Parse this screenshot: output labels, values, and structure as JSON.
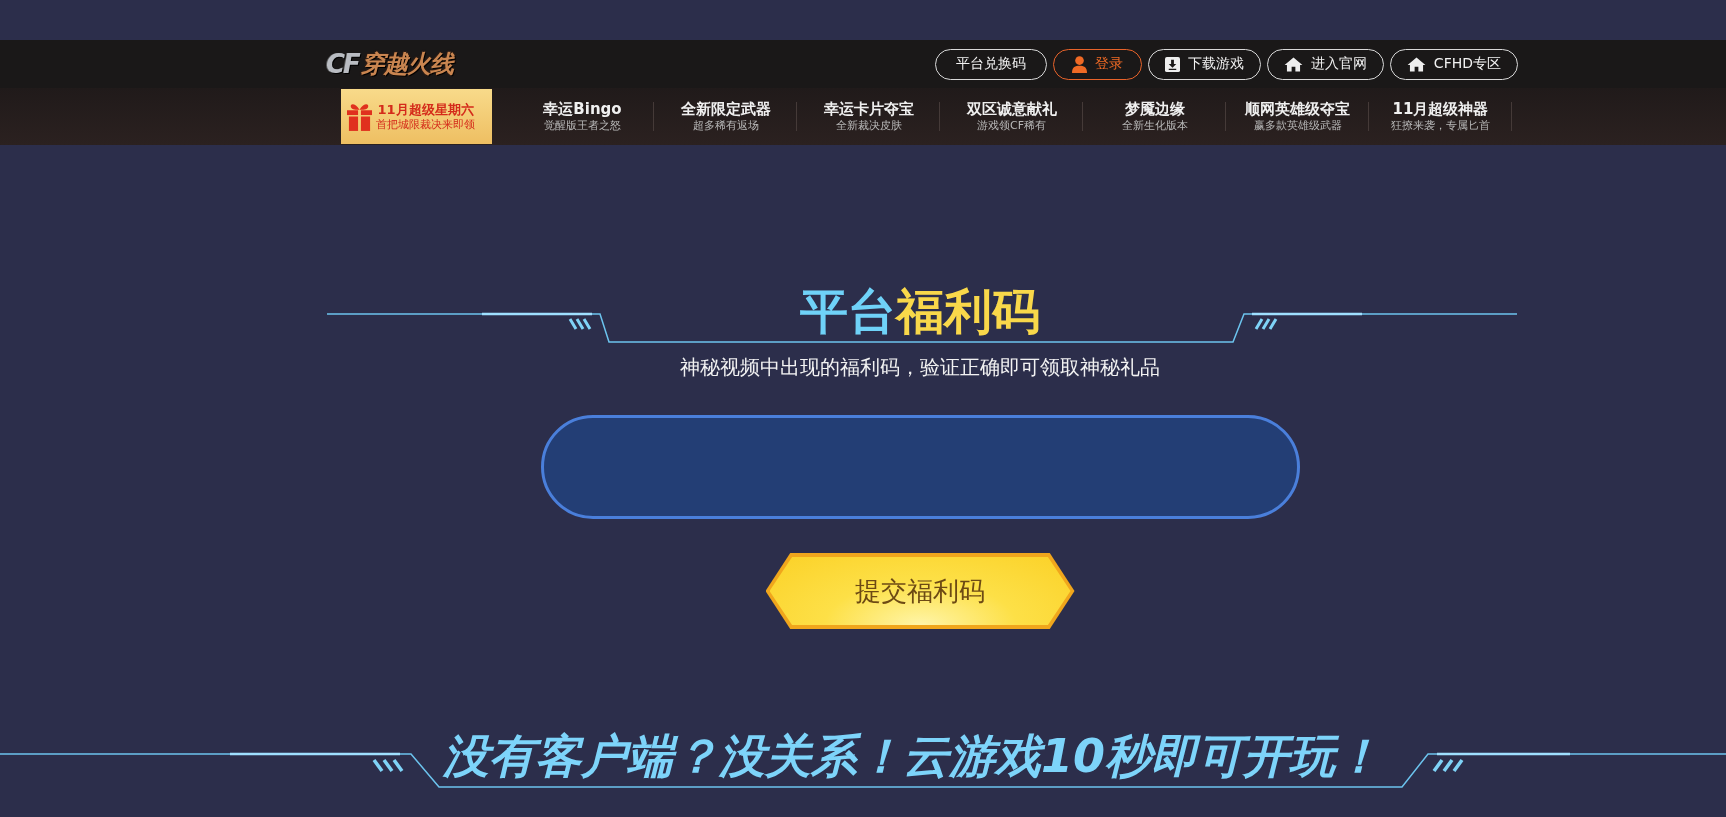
{
  "logo": {
    "mark": "CF",
    "name": "穿越火线"
  },
  "header_buttons": [
    {
      "label": "平台兑换码",
      "kind": "plain"
    },
    {
      "label": "登录",
      "kind": "login"
    },
    {
      "label": "下载游戏",
      "kind": "download"
    },
    {
      "label": "进入官网",
      "kind": "home"
    },
    {
      "label": "CFHD专区",
      "kind": "home"
    }
  ],
  "promo": {
    "title": "11月超级星期六",
    "subtitle": "首把城限裁决来即领"
  },
  "nav": [
    {
      "title": "幸运Bingo",
      "subtitle": "觉醒版王者之怒"
    },
    {
      "title": "全新限定武器",
      "subtitle": "超多稀有返场"
    },
    {
      "title": "幸运卡片夺宝",
      "subtitle": "全新裁决皮肤"
    },
    {
      "title": "双区诚意献礼",
      "subtitle": "游戏领CF稀有"
    },
    {
      "title": "梦魇边缘",
      "subtitle": "全新生化版本"
    },
    {
      "title": "顺网英雄级夺宝",
      "subtitle": "赢多款英雄级武器"
    },
    {
      "title": "11月超级神器",
      "subtitle": "狂撩来袭，专属匕首"
    }
  ],
  "redeem": {
    "title": {
      "lead": "平台",
      "accent": "福利码"
    },
    "subtitle": "神秘视频中出现的福利码，验证正确即可领取神秘礼品",
    "submit": "提交福利码"
  },
  "cloud_banner": {
    "title": "没有客户端？没关系！云游戏10秒即可开玩！"
  }
}
